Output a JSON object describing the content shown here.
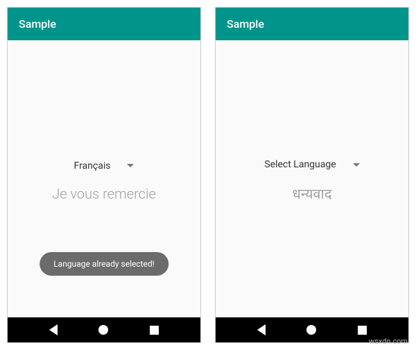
{
  "left": {
    "title": "Sample",
    "spinner": "Français",
    "message": "Je vous remercie",
    "toast": "Language already selected!"
  },
  "right": {
    "title": "Sample",
    "spinner": "Select Language",
    "message": "धन्यवाद"
  },
  "watermark": "wsxdn.com"
}
